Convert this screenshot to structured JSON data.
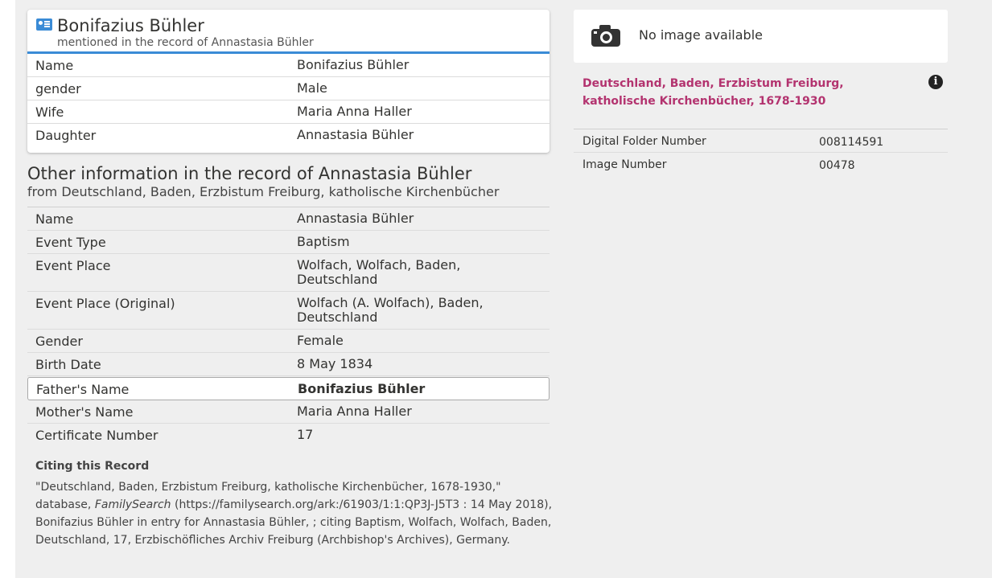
{
  "person": {
    "name": "Bonifazius Bühler",
    "subtitle": "mentioned in the record of Annastasia Bühler",
    "rows": [
      {
        "label": "Name",
        "value": "Bonifazius Bühler"
      },
      {
        "label": "gender",
        "value": "Male"
      },
      {
        "label": "Wife",
        "value": "Maria Anna Haller"
      },
      {
        "label": "Daughter",
        "value": "Annastasia Bühler"
      }
    ]
  },
  "other": {
    "title": "Other information in the record of Annastasia Bühler",
    "subtitle": "from Deutschland, Baden, Erzbistum Freiburg, katholische Kirchenbücher",
    "rows": [
      {
        "label": "Name",
        "value": "Annastasia Bühler"
      },
      {
        "label": "Event Type",
        "value": "Baptism"
      },
      {
        "label": "Event Place",
        "value": "Wolfach, Wolfach, Baden, Deutschland"
      },
      {
        "label": "Event Place (Original)",
        "value": "Wolfach (A. Wolfach), Baden, Deutschland"
      },
      {
        "label": "Gender",
        "value": "Female"
      },
      {
        "label": "Birth Date",
        "value": "8 May 1834"
      },
      {
        "label": "Father's Name",
        "value": "Bonifazius Bühler"
      },
      {
        "label": "Mother's Name",
        "value": "Maria Anna Haller"
      },
      {
        "label": "Certificate Number",
        "value": "17"
      }
    ]
  },
  "citing": {
    "heading": "Citing this Record",
    "text_before": "\"Deutschland, Baden, Erzbistum Freiburg, katholische Kirchenbücher, 1678-1930,\" database, ",
    "text_em": "FamilySearch",
    "text_after": " (https://familysearch.org/ark:/61903/1:1:QP3J-J5T3 : 14 May 2018), Bonifazius Bühler in entry for Annastasia Bühler, ; citing Baptism, Wolfach, Wolfach, Baden, Deutschland, 17, Erzbischöfliches Archiv Freiburg (Archbishop's Archives), Germany."
  },
  "image_panel": {
    "icon": "camera-icon",
    "text": "No image available"
  },
  "collection": {
    "title": "Deutschland, Baden, Erzbistum Freiburg, katholische Kirchenbücher, 1678-1930",
    "info_icon": "i"
  },
  "meta": [
    {
      "label": "Digital Folder Number",
      "value": "008114591"
    },
    {
      "label": "Image Number",
      "value": "00478"
    }
  ],
  "colors": {
    "link": "#1e6cc0",
    "accent": "#3a8bd6",
    "collection": "#b3336f",
    "background": "#efefef"
  }
}
